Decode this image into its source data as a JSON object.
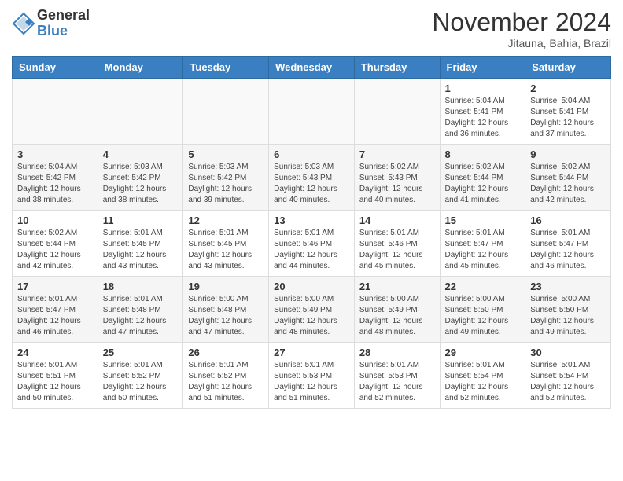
{
  "header": {
    "logo_general": "General",
    "logo_blue": "Blue",
    "month_title": "November 2024",
    "location": "Jitauna, Bahia, Brazil"
  },
  "days_of_week": [
    "Sunday",
    "Monday",
    "Tuesday",
    "Wednesday",
    "Thursday",
    "Friday",
    "Saturday"
  ],
  "weeks": [
    [
      {
        "day": "",
        "info": ""
      },
      {
        "day": "",
        "info": ""
      },
      {
        "day": "",
        "info": ""
      },
      {
        "day": "",
        "info": ""
      },
      {
        "day": "",
        "info": ""
      },
      {
        "day": "1",
        "info": "Sunrise: 5:04 AM\nSunset: 5:41 PM\nDaylight: 12 hours\nand 36 minutes."
      },
      {
        "day": "2",
        "info": "Sunrise: 5:04 AM\nSunset: 5:41 PM\nDaylight: 12 hours\nand 37 minutes."
      }
    ],
    [
      {
        "day": "3",
        "info": "Sunrise: 5:04 AM\nSunset: 5:42 PM\nDaylight: 12 hours\nand 38 minutes."
      },
      {
        "day": "4",
        "info": "Sunrise: 5:03 AM\nSunset: 5:42 PM\nDaylight: 12 hours\nand 38 minutes."
      },
      {
        "day": "5",
        "info": "Sunrise: 5:03 AM\nSunset: 5:42 PM\nDaylight: 12 hours\nand 39 minutes."
      },
      {
        "day": "6",
        "info": "Sunrise: 5:03 AM\nSunset: 5:43 PM\nDaylight: 12 hours\nand 40 minutes."
      },
      {
        "day": "7",
        "info": "Sunrise: 5:02 AM\nSunset: 5:43 PM\nDaylight: 12 hours\nand 40 minutes."
      },
      {
        "day": "8",
        "info": "Sunrise: 5:02 AM\nSunset: 5:44 PM\nDaylight: 12 hours\nand 41 minutes."
      },
      {
        "day": "9",
        "info": "Sunrise: 5:02 AM\nSunset: 5:44 PM\nDaylight: 12 hours\nand 42 minutes."
      }
    ],
    [
      {
        "day": "10",
        "info": "Sunrise: 5:02 AM\nSunset: 5:44 PM\nDaylight: 12 hours\nand 42 minutes."
      },
      {
        "day": "11",
        "info": "Sunrise: 5:01 AM\nSunset: 5:45 PM\nDaylight: 12 hours\nand 43 minutes."
      },
      {
        "day": "12",
        "info": "Sunrise: 5:01 AM\nSunset: 5:45 PM\nDaylight: 12 hours\nand 43 minutes."
      },
      {
        "day": "13",
        "info": "Sunrise: 5:01 AM\nSunset: 5:46 PM\nDaylight: 12 hours\nand 44 minutes."
      },
      {
        "day": "14",
        "info": "Sunrise: 5:01 AM\nSunset: 5:46 PM\nDaylight: 12 hours\nand 45 minutes."
      },
      {
        "day": "15",
        "info": "Sunrise: 5:01 AM\nSunset: 5:47 PM\nDaylight: 12 hours\nand 45 minutes."
      },
      {
        "day": "16",
        "info": "Sunrise: 5:01 AM\nSunset: 5:47 PM\nDaylight: 12 hours\nand 46 minutes."
      }
    ],
    [
      {
        "day": "17",
        "info": "Sunrise: 5:01 AM\nSunset: 5:47 PM\nDaylight: 12 hours\nand 46 minutes."
      },
      {
        "day": "18",
        "info": "Sunrise: 5:01 AM\nSunset: 5:48 PM\nDaylight: 12 hours\nand 47 minutes."
      },
      {
        "day": "19",
        "info": "Sunrise: 5:00 AM\nSunset: 5:48 PM\nDaylight: 12 hours\nand 47 minutes."
      },
      {
        "day": "20",
        "info": "Sunrise: 5:00 AM\nSunset: 5:49 PM\nDaylight: 12 hours\nand 48 minutes."
      },
      {
        "day": "21",
        "info": "Sunrise: 5:00 AM\nSunset: 5:49 PM\nDaylight: 12 hours\nand 48 minutes."
      },
      {
        "day": "22",
        "info": "Sunrise: 5:00 AM\nSunset: 5:50 PM\nDaylight: 12 hours\nand 49 minutes."
      },
      {
        "day": "23",
        "info": "Sunrise: 5:00 AM\nSunset: 5:50 PM\nDaylight: 12 hours\nand 49 minutes."
      }
    ],
    [
      {
        "day": "24",
        "info": "Sunrise: 5:01 AM\nSunset: 5:51 PM\nDaylight: 12 hours\nand 50 minutes."
      },
      {
        "day": "25",
        "info": "Sunrise: 5:01 AM\nSunset: 5:52 PM\nDaylight: 12 hours\nand 50 minutes."
      },
      {
        "day": "26",
        "info": "Sunrise: 5:01 AM\nSunset: 5:52 PM\nDaylight: 12 hours\nand 51 minutes."
      },
      {
        "day": "27",
        "info": "Sunrise: 5:01 AM\nSunset: 5:53 PM\nDaylight: 12 hours\nand 51 minutes."
      },
      {
        "day": "28",
        "info": "Sunrise: 5:01 AM\nSunset: 5:53 PM\nDaylight: 12 hours\nand 52 minutes."
      },
      {
        "day": "29",
        "info": "Sunrise: 5:01 AM\nSunset: 5:54 PM\nDaylight: 12 hours\nand 52 minutes."
      },
      {
        "day": "30",
        "info": "Sunrise: 5:01 AM\nSunset: 5:54 PM\nDaylight: 12 hours\nand 52 minutes."
      }
    ]
  ]
}
